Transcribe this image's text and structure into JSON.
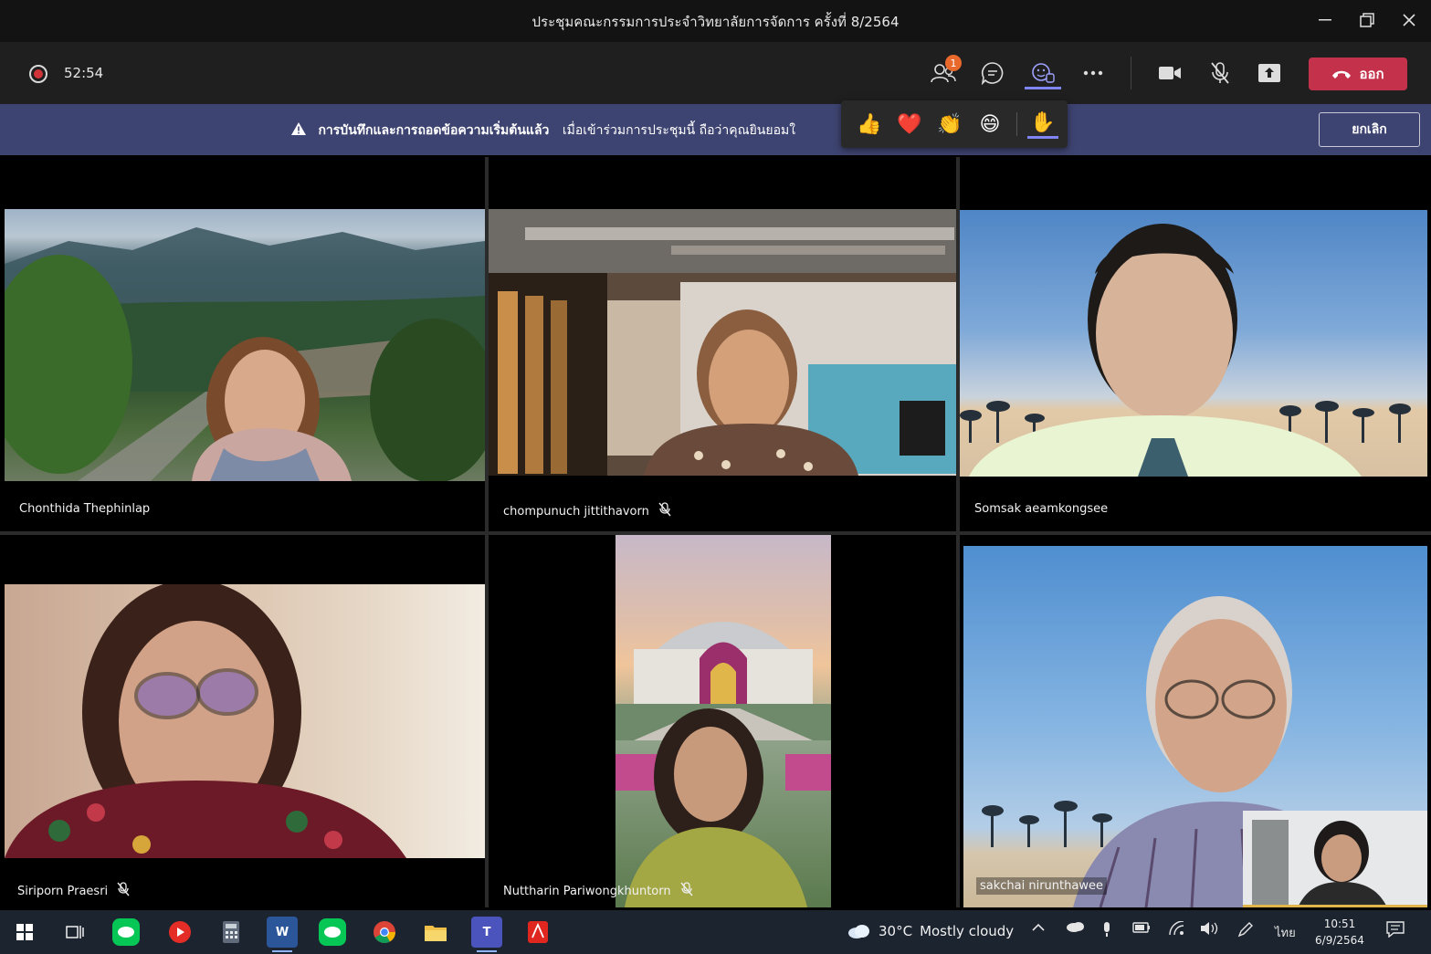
{
  "window": {
    "title": "ประชุมคณะกรรมการประจำวิทยาลัยการจัดการ ครั้งที่ 8/2564",
    "minimize_icon": "minimize-icon",
    "restore_icon": "restore-icon",
    "close_icon": "close-icon"
  },
  "toolbar": {
    "recording_timer": "52:54",
    "participants_badge": "1",
    "leave_label": "ออก"
  },
  "banner": {
    "bold_text": "การบันทึกและการถอดข้อความเริ่มต้นแล้ว",
    "text": "เมื่อเข้าร่วมการประชุมนี้ ถือว่าคุณยินยอมใ",
    "dismiss_label": "ยกเลิก"
  },
  "reactions": {
    "like": "👍",
    "heart": "❤️",
    "applause": "👏",
    "laugh": "😄",
    "raise_hand": "✋"
  },
  "participants": [
    {
      "name": "Chonthida Thephinlap",
      "muted": false
    },
    {
      "name": "chompunuch jittithavorn",
      "muted": true
    },
    {
      "name": "Somsak aeamkongsee",
      "muted": false
    },
    {
      "name": "Siriporn Praesri",
      "muted": true
    },
    {
      "name": "Nuttharin Pariwongkhuntorn",
      "muted": true
    },
    {
      "name": "sakchai nirunthawee",
      "muted": false
    }
  ],
  "taskbar": {
    "weather_temp": "30°C",
    "weather_desc": "Mostly cloudy",
    "language": "ไทย",
    "time": "10:51",
    "date": "6/9/2564"
  }
}
